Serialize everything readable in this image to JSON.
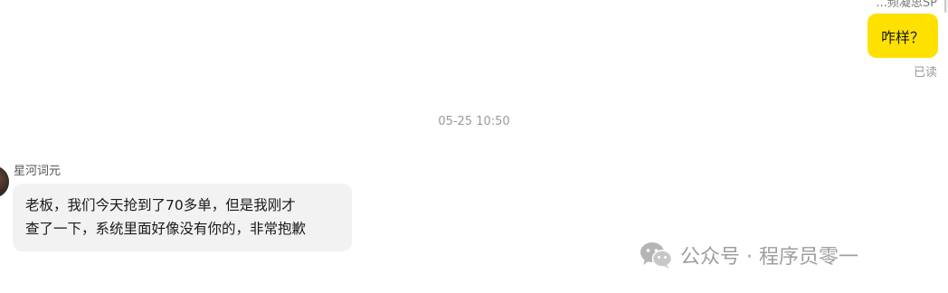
{
  "top_partial_name": "...频凝思SP",
  "outgoing_message": {
    "text": "咋样？",
    "status": "已读"
  },
  "timestamp": "05-25 10:50",
  "incoming_message": {
    "sender": "星河词元",
    "line1": "老板，我们今天抢到了70多单，但是我刚才",
    "line2": "查了一下，系统里面好像没有你的，非常抱歉"
  },
  "watermark": {
    "icon": "wechat-icon",
    "text": "公众号 · 程序员零一"
  },
  "colors": {
    "outgoing_bubble": "#ffe100",
    "incoming_bubble": "#f2f2f2",
    "muted_text": "#9a9a9a"
  }
}
